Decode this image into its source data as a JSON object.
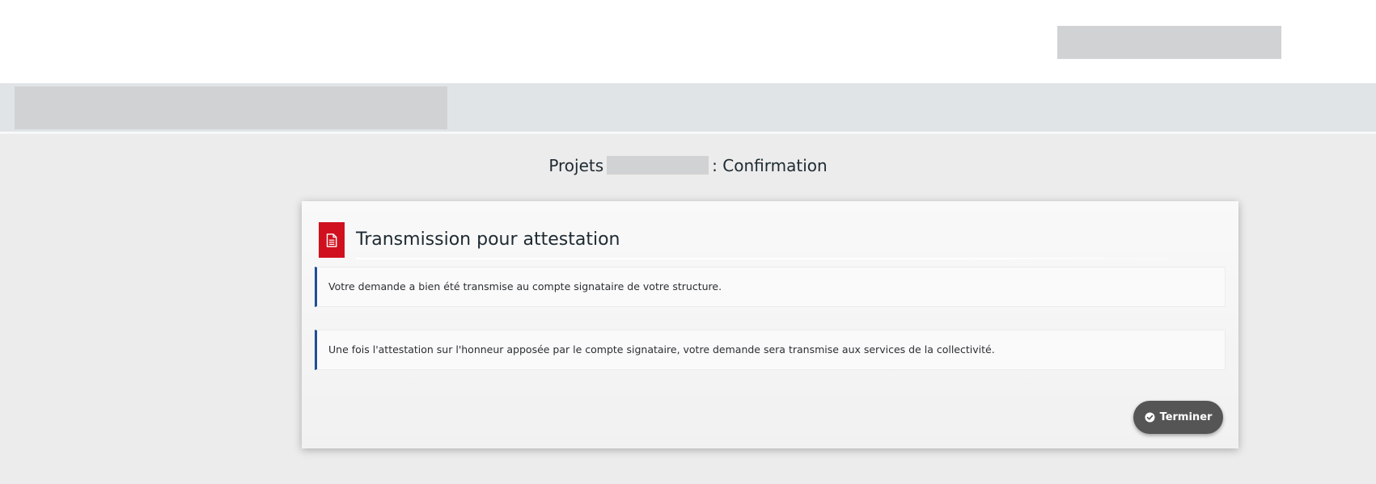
{
  "page": {
    "title_prefix": "Projets",
    "title_suffix": ": Confirmation"
  },
  "card": {
    "icon": "file-text-icon",
    "title": "Transmission pour attestation",
    "notices": [
      "Votre demande a bien été transmise au compte signataire de votre structure.",
      "Une fois l'attestation sur l'honneur apposée par le compte signataire, votre demande sera transmise aux services de la collectivité."
    ],
    "finish_button": {
      "label": "Terminer",
      "icon": "check-circle-icon"
    }
  },
  "colors": {
    "accent_red": "#d0101e",
    "notice_border_blue": "#1f4e9a",
    "button_gray": "#555555",
    "navbar_bg": "#e0e4e7",
    "page_bg": "#ececec"
  }
}
